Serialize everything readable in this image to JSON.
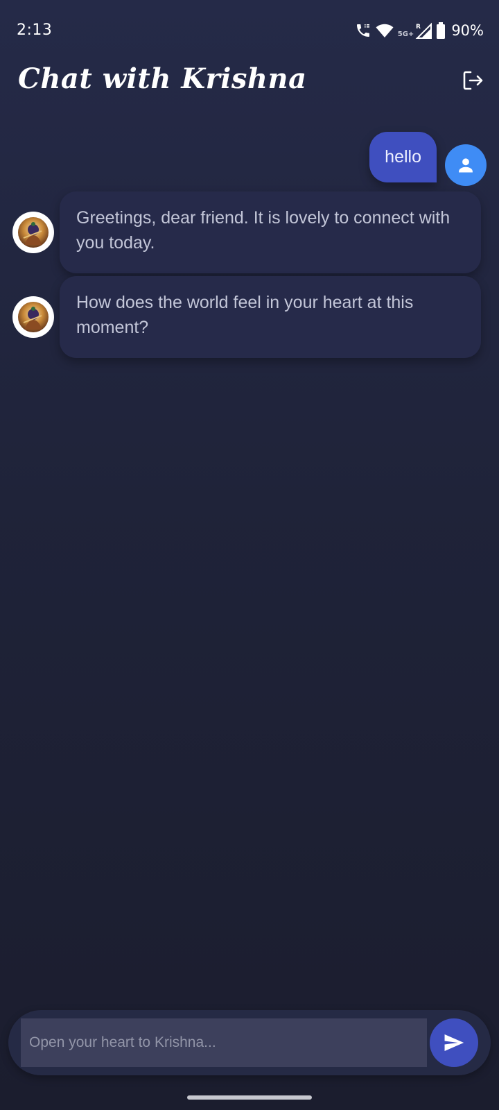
{
  "status_bar": {
    "time": "2:13",
    "network": "5G+",
    "battery": "90%",
    "icons": [
      "wifi-calling-icon",
      "wifi-icon",
      "signal-roaming-icon",
      "battery-icon"
    ]
  },
  "header": {
    "title": "Chat with Krishna",
    "logout_icon": "logout-icon"
  },
  "messages": [
    {
      "sender": "user",
      "text": "hello"
    },
    {
      "sender": "krishna",
      "text": "Greetings, dear friend. It is lovely to connect with you today."
    },
    {
      "sender": "krishna",
      "text": "How does the world feel in your heart at this moment?"
    }
  ],
  "composer": {
    "placeholder": "Open your heart to Krishna...",
    "value": "",
    "send_icon": "send-icon"
  },
  "colors": {
    "background_top": "#252a48",
    "background_bottom": "#1b1d2e",
    "user_bubble": "#3f4fbf",
    "bot_bubble": "#262a4a",
    "user_avatar": "#3f8cf5",
    "send_button": "#3f4fbf"
  }
}
